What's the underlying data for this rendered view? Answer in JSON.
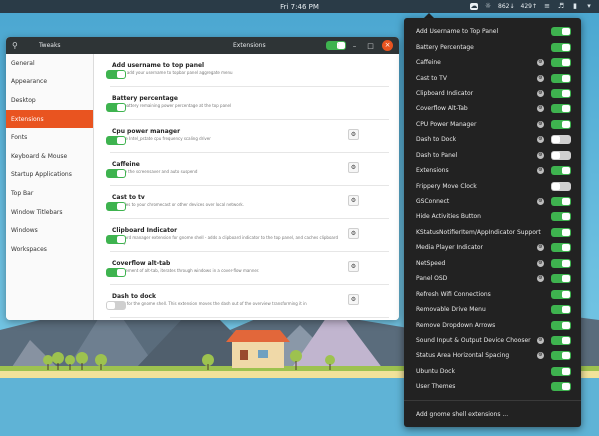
{
  "topbar": {
    "clock": "Fri 7:46 PM",
    "tray": [
      {
        "icon": "extensions-icon",
        "text": ""
      },
      {
        "icon": "weather-icon",
        "text": ""
      },
      {
        "icon": "download-icon",
        "text": "862"
      },
      {
        "icon": "upload-icon",
        "text": "429"
      },
      {
        "icon": "network-icon",
        "text": ""
      },
      {
        "icon": "volume-icon",
        "text": ""
      },
      {
        "icon": "battery-icon",
        "text": ""
      },
      {
        "icon": "power-icon",
        "text": ""
      }
    ],
    "net_down": "862",
    "net_up": "429"
  },
  "tweaks": {
    "app_title": "Tweaks",
    "section_title": "Extensions",
    "sidebar": [
      {
        "label": "General",
        "selected": false
      },
      {
        "label": "Appearance",
        "selected": false
      },
      {
        "label": "Desktop",
        "selected": false
      },
      {
        "label": "Extensions",
        "selected": true
      },
      {
        "label": "Fonts",
        "selected": false
      },
      {
        "label": "Keyboard & Mouse",
        "selected": false
      },
      {
        "label": "Startup Applications",
        "selected": false
      },
      {
        "label": "Top Bar",
        "selected": false
      },
      {
        "label": "Window Titlebars",
        "selected": false
      },
      {
        "label": "Windows",
        "selected": false
      },
      {
        "label": "Workspaces",
        "selected": false
      }
    ],
    "extensions": [
      {
        "title": "Add username to top panel",
        "desc": "Simply add your username to topbar panel aggregate menu",
        "gear": false,
        "on": true
      },
      {
        "title": "Battery percentage",
        "desc": "Show battery remaining power percentage at the top panel",
        "gear": false,
        "on": true
      },
      {
        "title": "Cpu power manager",
        "desc": "Manage Intel_pstate cpu frequency scaling driver",
        "gear": true,
        "on": true
      },
      {
        "title": "Caffeine",
        "desc": "Disable the screensaver and auto suspend",
        "gear": true,
        "on": true
      },
      {
        "title": "Cast to tv",
        "desc": "Cast files to your chromecast or other devices over local network.",
        "gear": true,
        "on": true
      },
      {
        "title": "Clipboard Indicator",
        "desc": "Clipboard manager extension for gnome shell - adds a clipboard indicator to the top panel, and caches clipboard history.",
        "gear": true,
        "on": true
      },
      {
        "title": "Coverflow alt-tab",
        "desc": "Replacement of alt-tab, iterates through windows in a cover-flow manner.",
        "gear": true,
        "on": true
      },
      {
        "title": "Dash to dock",
        "desc": "A dock for the gnome shell. This extension moves the dash out of the overview transforming it in",
        "gear": true,
        "on": false
      }
    ]
  },
  "menu": {
    "items": [
      {
        "label": "Add Username to Top Panel",
        "gear": false,
        "on": true
      },
      {
        "label": "Battery Percentage",
        "gear": false,
        "on": true
      },
      {
        "label": "Caffeine",
        "gear": true,
        "on": true
      },
      {
        "label": "Cast to TV",
        "gear": true,
        "on": true
      },
      {
        "label": "Clipboard Indicator",
        "gear": true,
        "on": true
      },
      {
        "label": "Coverflow Alt-Tab",
        "gear": true,
        "on": true
      },
      {
        "label": "CPU Power Manager",
        "gear": true,
        "on": true
      },
      {
        "label": "Dash to Dock",
        "gear": true,
        "on": false
      },
      {
        "label": "Dash to Panel",
        "gear": true,
        "on": false
      },
      {
        "label": "Extensions",
        "gear": true,
        "on": true
      },
      {
        "label": "Frippery Move Clock",
        "gear": false,
        "on": false
      },
      {
        "label": "GSConnect",
        "gear": true,
        "on": true
      },
      {
        "label": "Hide Activities Button",
        "gear": false,
        "on": true
      },
      {
        "label": "KStatusNotifierItem/AppIndicator Support",
        "gear": false,
        "on": true
      },
      {
        "label": "Media Player Indicator",
        "gear": true,
        "on": true
      },
      {
        "label": "NetSpeed",
        "gear": true,
        "on": true
      },
      {
        "label": "Panel OSD",
        "gear": true,
        "on": true
      },
      {
        "label": "Refresh Wifi Connections",
        "gear": false,
        "on": true
      },
      {
        "label": "Removable Drive Menu",
        "gear": false,
        "on": true
      },
      {
        "label": "Remove Dropdown Arrows",
        "gear": false,
        "on": true
      },
      {
        "label": "Sound Input & Output Device Chooser",
        "gear": true,
        "on": true
      },
      {
        "label": "Status Area Horizontal Spacing",
        "gear": true,
        "on": true
      },
      {
        "label": "Ubuntu Dock",
        "gear": false,
        "on": true
      },
      {
        "label": "User Themes",
        "gear": false,
        "on": true
      }
    ],
    "footer": "Add gnome shell extensions ..."
  },
  "colors": {
    "accent": "#e95420",
    "toggle_on": "#3eb34f",
    "toggle_off": "#cfcfcf",
    "menu_bg": "#222222",
    "topbar_bg": "#2a3b47"
  }
}
